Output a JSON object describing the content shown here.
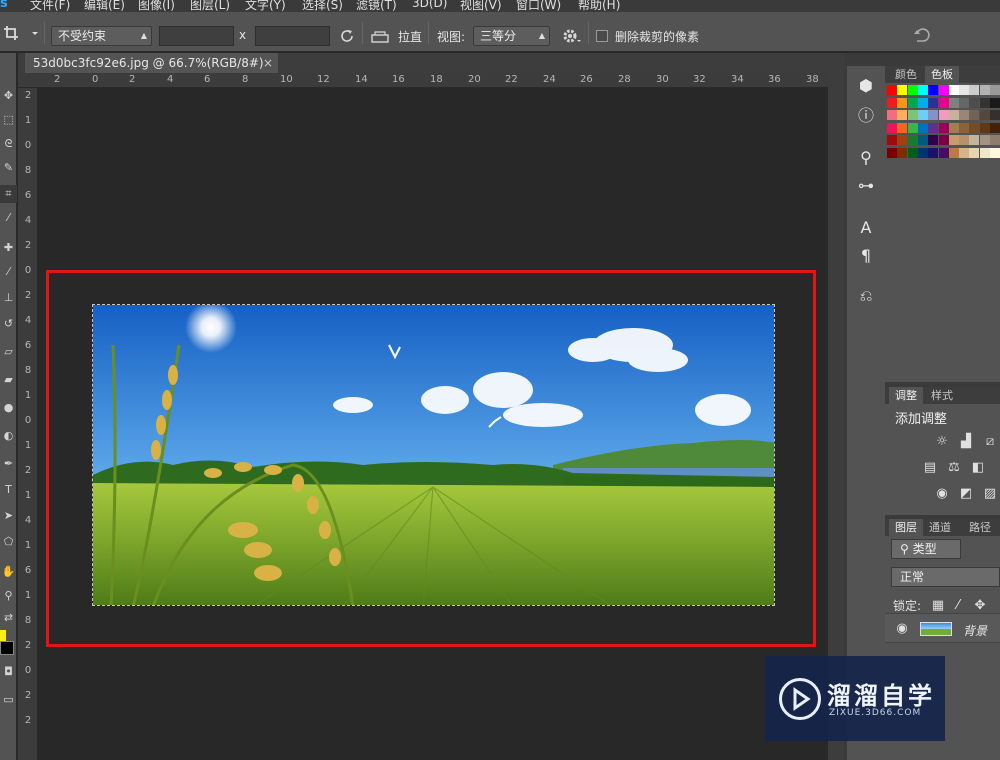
{
  "menu": {
    "app_logo": "s",
    "items": [
      "文件(F)",
      "编辑(E)",
      "图像(I)",
      "图层(L)",
      "文字(Y)",
      "选择(S)",
      "滤镜(T)",
      "3D(D)",
      "视图(V)",
      "窗口(W)",
      "帮助(H)"
    ]
  },
  "options": {
    "constraint": "不受约束",
    "x_sep": "x",
    "straighten_label": "拉直",
    "view_label": "视图:",
    "view_value": "三等分",
    "delete_cropped_label": "删除裁剪的像素"
  },
  "document": {
    "tab_title": "53d0bc3fc92e6.jpg @ 66.7%(RGB/8#)",
    "close_glyph": "×"
  },
  "rulers": {
    "horizontal": [
      "2",
      "0",
      "2",
      "4",
      "6",
      "8",
      "10",
      "12",
      "14",
      "16",
      "18",
      "20",
      "22",
      "24",
      "26",
      "28",
      "30",
      "32",
      "34",
      "36",
      "38"
    ],
    "vertical": [
      "2",
      "1",
      "0",
      "8",
      "6",
      "4",
      "2",
      "0",
      "2",
      "4",
      "6",
      "8",
      "1",
      "0",
      "1",
      "2",
      "1",
      "4",
      "1",
      "6",
      "1",
      "8",
      "2",
      "0",
      "2",
      "2"
    ]
  },
  "tools": {
    "icons": [
      "move-icon",
      "marquee-icon",
      "lasso-icon",
      "quick-select-icon",
      "crop-icon",
      "eyedropper-icon",
      "healing-icon",
      "brush-icon",
      "stamp-icon",
      "history-brush-icon",
      "eraser-icon",
      "gradient-icon",
      "blur-icon",
      "dodge-icon",
      "pen-icon",
      "type-icon",
      "path-select-icon",
      "shape-icon",
      "hand-icon",
      "zoom-icon"
    ],
    "foreground_color": "#ffec1a",
    "background_color": "#000000"
  },
  "panels": {
    "color_tabs": [
      "颜色",
      "色板"
    ],
    "adjust_tabs": [
      "调整",
      "样式"
    ],
    "adjust_title": "添加调整",
    "layers_tabs": [
      "图层",
      "通道",
      "路径"
    ],
    "filter_kind": "类型",
    "blend_mode": "正常",
    "lock_label": "锁定:",
    "layer_name": "背景"
  },
  "watermark": {
    "title": "溜溜自学",
    "subtitle": "ZIXUE.3D66.COM"
  },
  "colors": {
    "accent": "#e01616",
    "panel_bg": "#535353"
  }
}
